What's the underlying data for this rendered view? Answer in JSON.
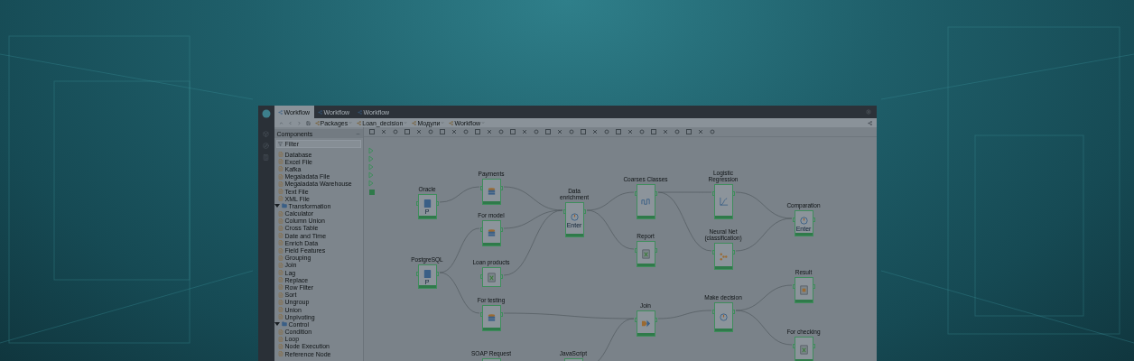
{
  "window": {
    "tabs": [
      {
        "label": "Workflow",
        "selected": true
      },
      {
        "label": "Workflow",
        "selected": false
      },
      {
        "label": "Workflow",
        "selected": false
      }
    ],
    "breadcrumbs": [
      {
        "label": "Packages"
      },
      {
        "label": "Loan_decision"
      },
      {
        "label": "Модули"
      },
      {
        "label": "Workflow"
      }
    ]
  },
  "components_panel": {
    "title": "Components",
    "filter": {
      "placeholder": "Filter"
    },
    "tree": [
      {
        "children": [
          {
            "label": "Database"
          },
          {
            "label": "Excel File"
          },
          {
            "label": "Kafka"
          },
          {
            "label": "Megaladata File"
          },
          {
            "label": "Megaladata Warehouse"
          },
          {
            "label": "Text File"
          },
          {
            "label": "XML File"
          }
        ]
      },
      {
        "label": "Transformation",
        "expanded": true,
        "children": [
          {
            "label": "Calculator"
          },
          {
            "label": "Column Union"
          },
          {
            "label": "Cross Table"
          },
          {
            "label": "Date and Time"
          },
          {
            "label": "Enrich Data"
          },
          {
            "label": "Field Features"
          },
          {
            "label": "Grouping"
          },
          {
            "label": "Join"
          },
          {
            "label": "Lag"
          },
          {
            "label": "Replace"
          },
          {
            "label": "Row Filter"
          },
          {
            "label": "Sort"
          },
          {
            "label": "Ungroup"
          },
          {
            "label": "Union"
          },
          {
            "label": "Unpivoting"
          }
        ]
      },
      {
        "label": "Control",
        "expanded": true,
        "children": [
          {
            "label": "Condition"
          },
          {
            "label": "Loop"
          },
          {
            "label": "Node Execution"
          },
          {
            "label": "Reference Node"
          }
        ]
      }
    ]
  },
  "canvas": {
    "nodes": [
      {
        "label": "Oracle",
        "caption": "P",
        "executed": true
      },
      {
        "label": "PostgreSQL",
        "caption": "P",
        "executed": true
      },
      {
        "label": "Payments",
        "executed": true
      },
      {
        "label": "For model",
        "executed": true
      },
      {
        "label": "Loan products",
        "executed": false
      },
      {
        "label": "For testing",
        "executed": true
      },
      {
        "label": "SOAP Request",
        "executed": false
      },
      {
        "label": "Data\nenrichment",
        "caption": "Enter",
        "executed": true
      },
      {
        "label": "JavaScript",
        "executed": false
      },
      {
        "label": "Coarses Classes",
        "executed": true
      },
      {
        "label": "Report",
        "executed": true
      },
      {
        "label": "Join",
        "executed": true
      },
      {
        "label": "Logistic\nRegression",
        "executed": true
      },
      {
        "label": "Neural Net\n(classification)",
        "executed": true
      },
      {
        "label": "Make decision",
        "executed": true
      },
      {
        "label": "Comparation",
        "caption": "Enter",
        "executed": true
      },
      {
        "label": "Result",
        "executed": true
      },
      {
        "label": "For checking",
        "executed": true
      }
    ]
  }
}
